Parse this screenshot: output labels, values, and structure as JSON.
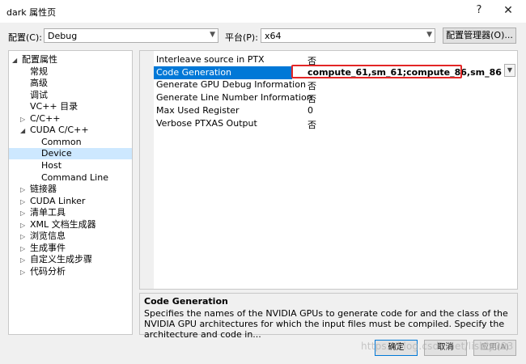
{
  "window": {
    "title": "dark 属性页",
    "help": "?",
    "close": "✕"
  },
  "config_row": {
    "config_label": "配置(C):",
    "config_value": "Debug",
    "platform_label": "平台(P):",
    "platform_value": "x64",
    "manager_button": "配置管理器(O)..."
  },
  "tree": [
    {
      "label": "配置属性",
      "expander": "◢",
      "indent": 0
    },
    {
      "label": "常规",
      "expander": "",
      "indent": 1
    },
    {
      "label": "高级",
      "expander": "",
      "indent": 1
    },
    {
      "label": "调试",
      "expander": "",
      "indent": 1
    },
    {
      "label": "VC++ 目录",
      "expander": "",
      "indent": 1
    },
    {
      "label": "C/C++",
      "expander": "▷",
      "indent": 1
    },
    {
      "label": "CUDA C/C++",
      "expander": "◢",
      "indent": 1
    },
    {
      "label": "Common",
      "expander": "",
      "indent": 2
    },
    {
      "label": "Device",
      "expander": "",
      "indent": 2,
      "selected": true
    },
    {
      "label": "Host",
      "expander": "",
      "indent": 2
    },
    {
      "label": "Command Line",
      "expander": "",
      "indent": 2
    },
    {
      "label": "链接器",
      "expander": "▷",
      "indent": 1
    },
    {
      "label": "CUDA Linker",
      "expander": "▷",
      "indent": 1
    },
    {
      "label": "清单工具",
      "expander": "▷",
      "indent": 1
    },
    {
      "label": "XML 文档生成器",
      "expander": "▷",
      "indent": 1
    },
    {
      "label": "浏览信息",
      "expander": "▷",
      "indent": 1
    },
    {
      "label": "生成事件",
      "expander": "▷",
      "indent": 1
    },
    {
      "label": "自定义生成步骤",
      "expander": "▷",
      "indent": 1
    },
    {
      "label": "代码分析",
      "expander": "▷",
      "indent": 1
    }
  ],
  "properties": [
    {
      "name": "Interleave source in PTX",
      "value": "否"
    },
    {
      "name": "Code Generation",
      "value": "compute_61,sm_61;compute_86,sm_86",
      "selected": true
    },
    {
      "name": "Generate GPU Debug Information",
      "value": "否"
    },
    {
      "name": "Generate Line Number Information",
      "value": "否"
    },
    {
      "name": "Max Used Register",
      "value": "0"
    },
    {
      "name": "Verbose PTXAS Output",
      "value": "否"
    }
  ],
  "description": {
    "title": "Code Generation",
    "text": "Specifies the names of the NVIDIA GPUs to generate code for and the class of the NVIDIA GPU architectures for which the input files must be compiled.  Specify the architecture and code in..."
  },
  "buttons": {
    "ok": "确定",
    "cancel": "取消",
    "apply": "应用(A)"
  },
  "watermark": "https://blog.csdn.net/lishiy093",
  "colors": {
    "selection": "#0078d7",
    "tree_selection": "#cde8ff",
    "highlight_box": "#e32626"
  }
}
